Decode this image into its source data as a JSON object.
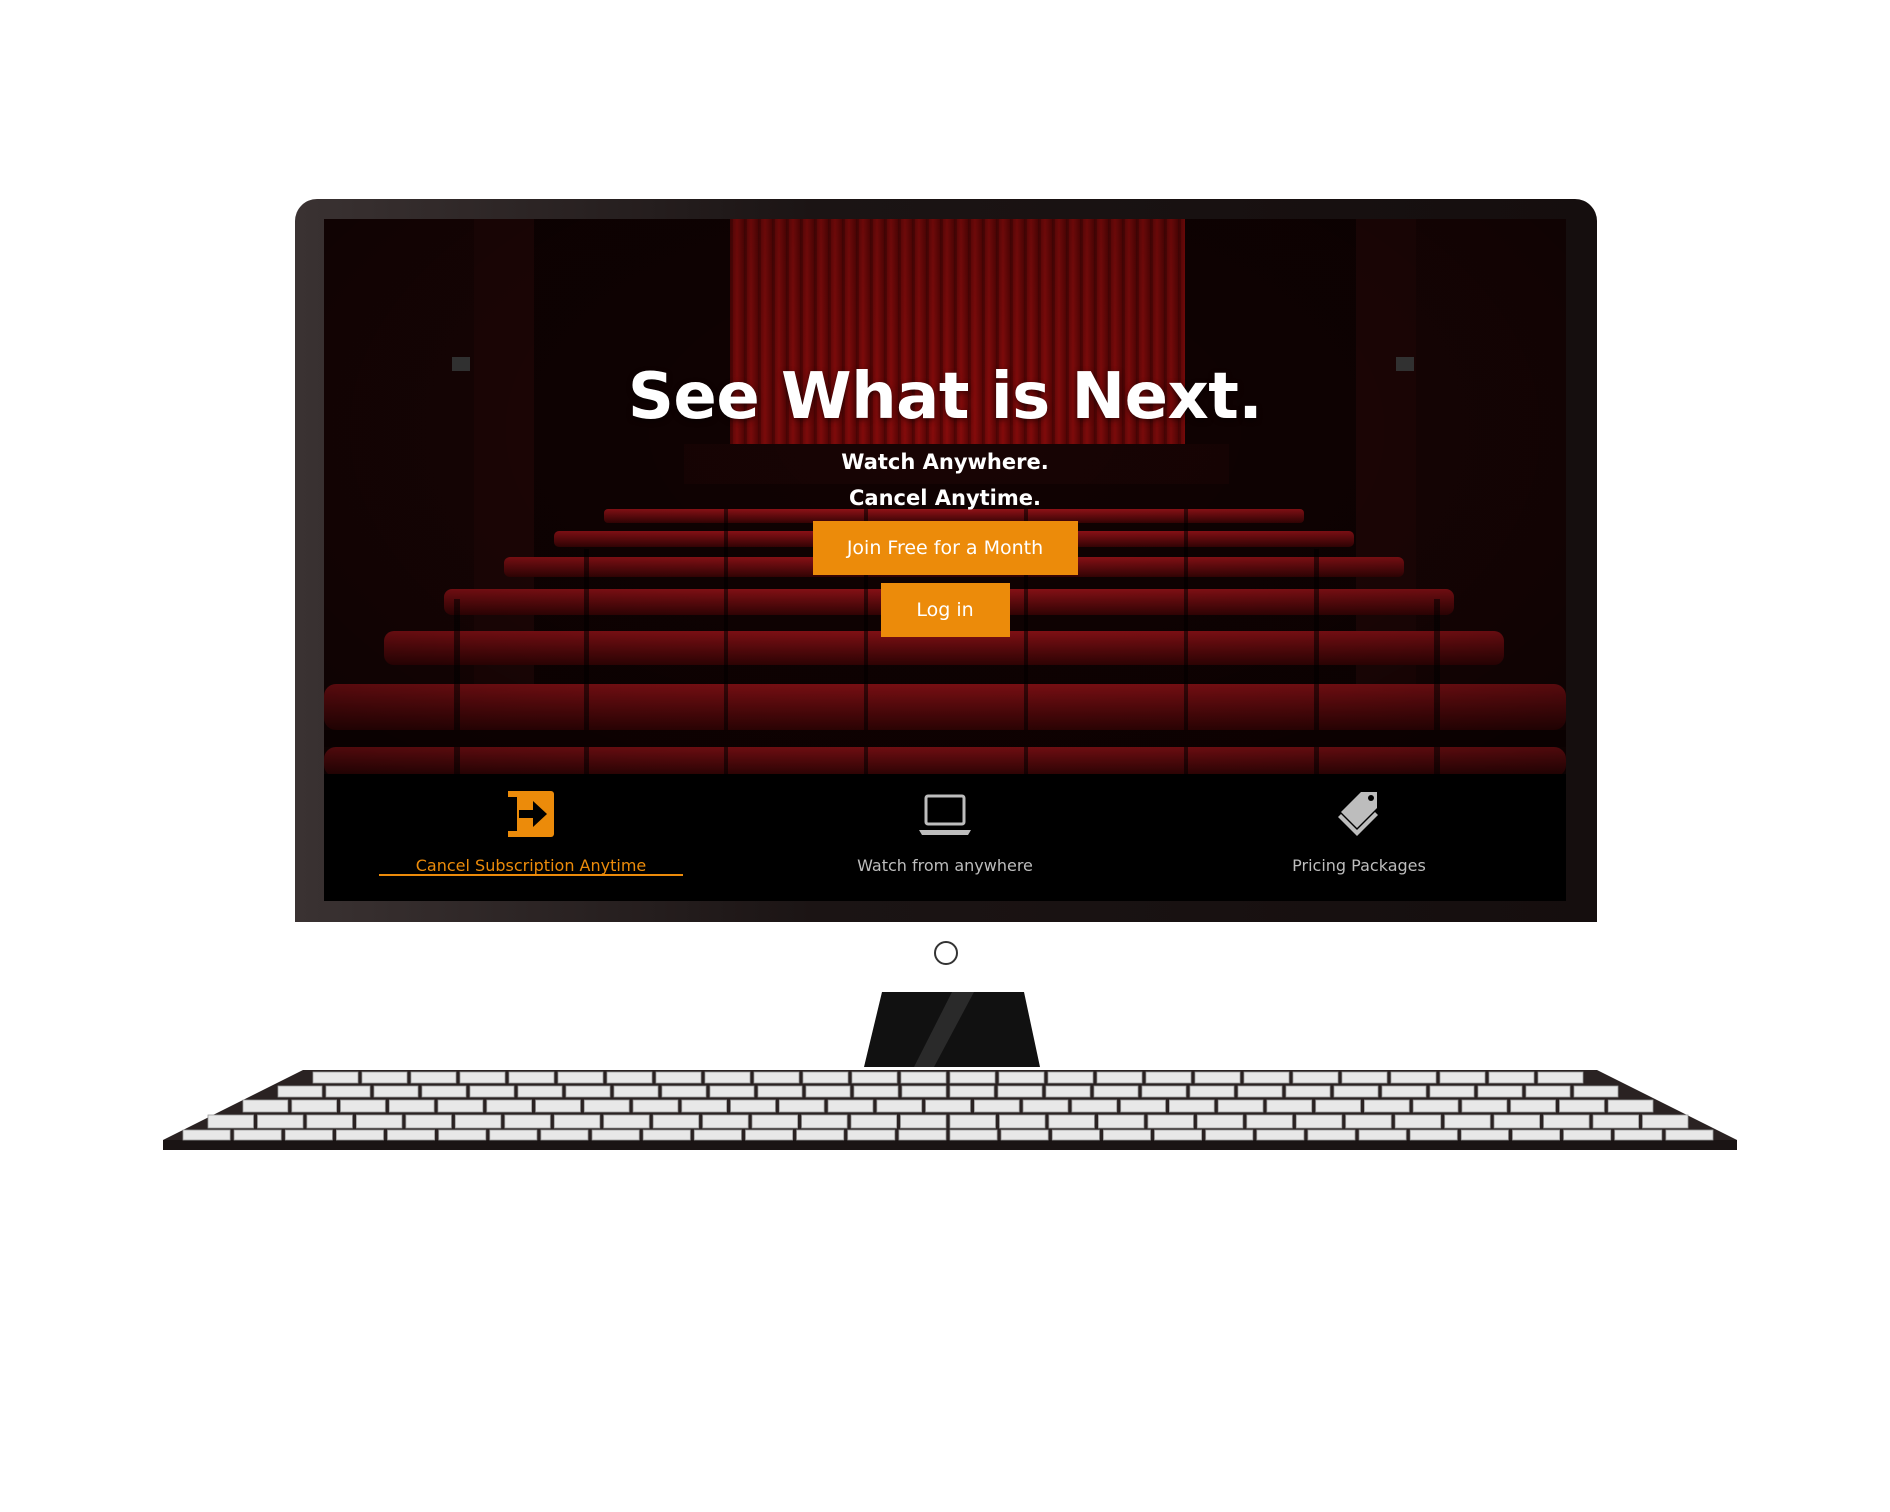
{
  "hero": {
    "title": "See What is Next.",
    "subtitle_1": "Watch Anywhere.",
    "subtitle_2": "Cancel Anytime.",
    "join_button": "Join Free for a Month",
    "login_button": "Log in"
  },
  "tabs": [
    {
      "label": "Cancel Subscription Anytime",
      "icon": "sign-in-icon",
      "active": true
    },
    {
      "label": "Watch from anywhere",
      "icon": "laptop-icon",
      "active": false
    },
    {
      "label": "Pricing Packages",
      "icon": "price-tags-icon",
      "active": false
    }
  ],
  "colors": {
    "accent": "#ec8b0a",
    "tab_bar": "#000000",
    "curtain": "#8a0c0c",
    "seat": "#7a0b0b",
    "inactive_text": "#bdbdbd"
  }
}
